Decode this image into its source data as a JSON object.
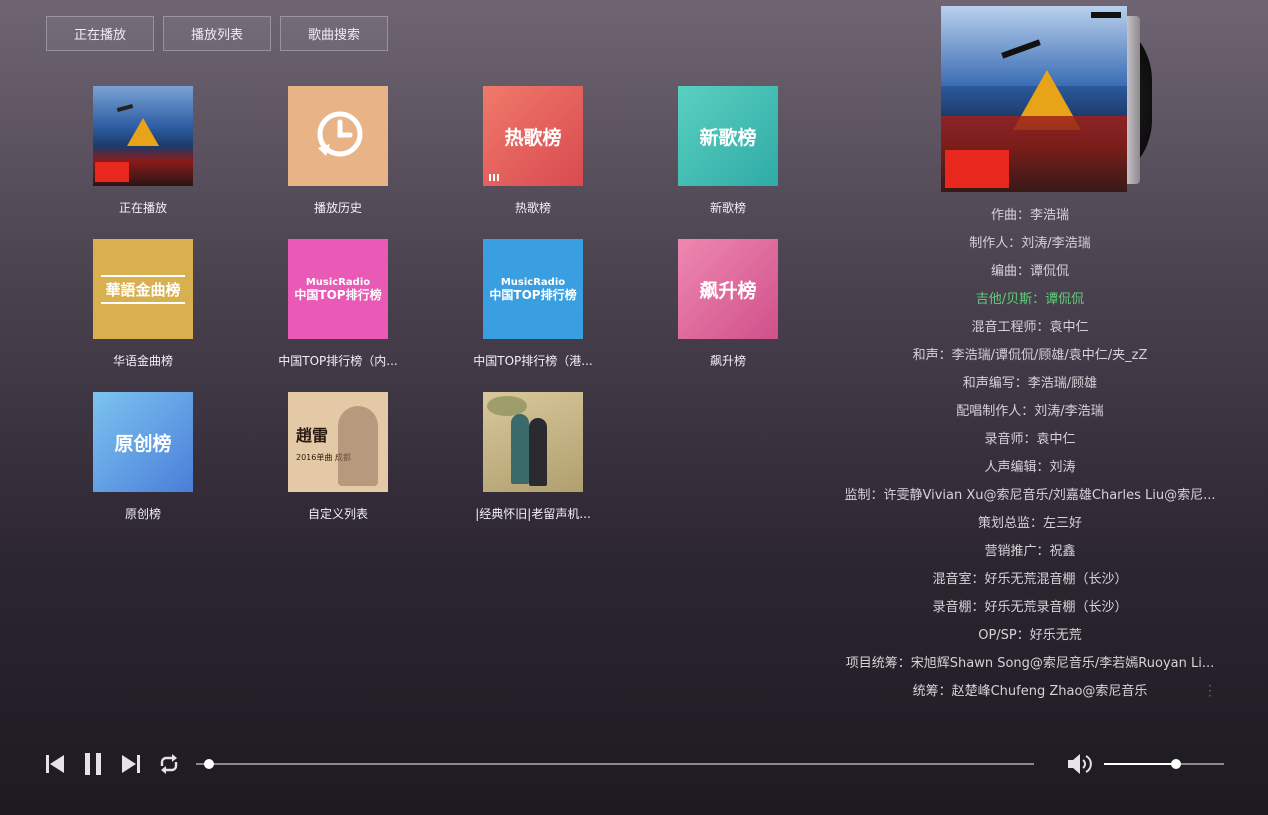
{
  "tabs": [
    {
      "label": "正在播放"
    },
    {
      "label": "播放列表"
    },
    {
      "label": "歌曲搜索"
    }
  ],
  "tiles": [
    {
      "label": "正在播放",
      "cover_icon": "album-art"
    },
    {
      "label": "播放历史",
      "cover_icon": "history-icon",
      "color": "#e8b487"
    },
    {
      "label": "热歌榜",
      "cover_text": "热歌榜",
      "color": "#e8625c"
    },
    {
      "label": "新歌榜",
      "cover_text": "新歌榜",
      "color": "#3fbcb0"
    },
    {
      "label": "华语金曲榜",
      "cover_text": "華語金曲榜",
      "color": "#d9b050"
    },
    {
      "label": "中国TOP排行榜（内...",
      "cover_text": "中国TOP排行榜",
      "cover_sub": "MusicRadio",
      "color": "#e85ab5"
    },
    {
      "label": "中国TOP排行榜（港...",
      "cover_text": "中国TOP排行榜",
      "cover_sub": "MusicRadio",
      "color": "#3a9fe0"
    },
    {
      "label": "飙升榜",
      "cover_text": "飙升榜",
      "color": "#e06ea0"
    },
    {
      "label": "原创榜",
      "cover_text": "原创榜",
      "color": "#5b9be0"
    },
    {
      "label": "自定义列表",
      "cover_text": "趙雷",
      "cover_sub": "2016单曲 成都",
      "color": "#e4c9a7"
    },
    {
      "label": "|经典怀旧|老留声机...",
      "cover_icon": "painting",
      "color": "#c9b98a"
    }
  ],
  "credits": [
    {
      "text": "作曲：李浩瑞"
    },
    {
      "text": "制作人：刘涛/李浩瑞"
    },
    {
      "text": "编曲：谭侃侃"
    },
    {
      "text": "吉他/贝斯：谭侃侃",
      "highlight": true
    },
    {
      "text": "混音工程师：袁中仁"
    },
    {
      "text": "和声：李浩瑞/谭侃侃/顾雄/袁中仁/夹_zZ"
    },
    {
      "text": "和声编写：李浩瑞/顾雄"
    },
    {
      "text": "配唱制作人：刘涛/李浩瑞"
    },
    {
      "text": "录音师：袁中仁"
    },
    {
      "text": "人声编辑：刘涛"
    },
    {
      "text": "监制：许雯静Vivian Xu@索尼音乐/刘嘉雄Charles Liu@索尼..."
    },
    {
      "text": "策划总监：左三好"
    },
    {
      "text": "营销推广：祝鑫"
    },
    {
      "text": "混音室：好乐无荒混音棚（长沙）"
    },
    {
      "text": "录音棚：好乐无荒录音棚（长沙）"
    },
    {
      "text": "OP/SP：好乐无荒"
    },
    {
      "text": "项目统筹：宋旭辉Shawn Song@索尼音乐/李若嫣Ruoyan Li..."
    },
    {
      "text": "统筹：赵楚峰Chufeng Zhao@索尼音乐"
    }
  ],
  "player": {
    "progress_fraction": 0.01,
    "volume_fraction": 0.6
  },
  "icons": {
    "prev": "skip-back-icon",
    "pause": "pause-icon",
    "next": "skip-forward-icon",
    "loop": "repeat-icon",
    "volume": "volume-icon"
  }
}
